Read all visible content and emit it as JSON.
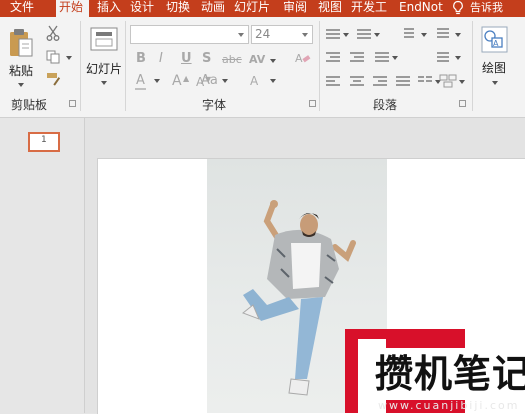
{
  "tabs": [
    "文件",
    "开始",
    "插入",
    "设计",
    "切换",
    "动画",
    "幻灯片",
    "审阅",
    "视图",
    "开发工",
    "EndNot"
  ],
  "active_tab": "开始",
  "tell_me": "告诉我",
  "clipboard": {
    "paste_label": "粘贴",
    "group_label": "剪贴板"
  },
  "slides_group": {
    "label": "幻灯片"
  },
  "font": {
    "name_value": "",
    "size_value": "24",
    "group_label": "字体",
    "bold": "B",
    "italic": "I",
    "underline": "U",
    "shadow": "S",
    "strike": "abc",
    "spacing": "AV",
    "font_color": "A",
    "grow": "A",
    "shrink": "A",
    "case": "Aa"
  },
  "paragraph": {
    "group_label": "段落"
  },
  "drawing": {
    "label": "绘图"
  },
  "thumbnail": {
    "number": "1"
  },
  "watermark": {
    "text": "攒机笔记",
    "url": "www.cuanjibiji.com"
  },
  "colors": {
    "accent": "#c43e1c",
    "watermark_red": "#d8102a"
  }
}
